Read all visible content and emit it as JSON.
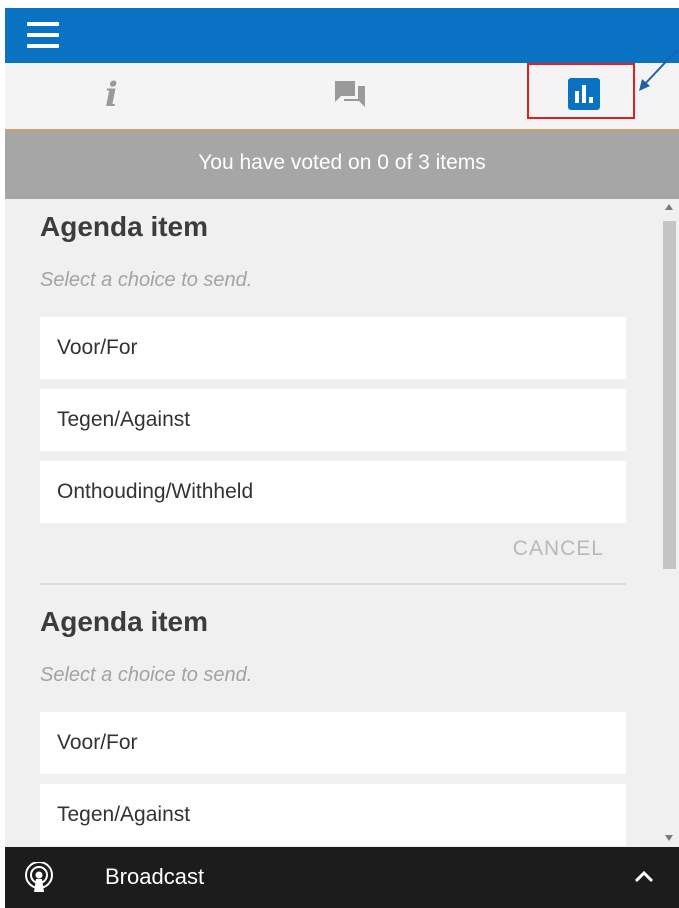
{
  "tabs": [
    {
      "id": "info",
      "icon": "info-icon"
    },
    {
      "id": "chat",
      "icon": "chat-icon"
    },
    {
      "id": "vote",
      "icon": "poll-icon",
      "active": true
    }
  ],
  "status": {
    "text": "You have voted on 0 of 3 items"
  },
  "agenda": [
    {
      "title": "Agenda item",
      "hint": "Select a choice to send.",
      "choices": [
        "Voor/For",
        "Tegen/Against",
        "Onthouding/Withheld"
      ],
      "cancel_label": "CANCEL"
    },
    {
      "title": "Agenda item",
      "hint": "Select a choice to send.",
      "choices": [
        "Voor/For",
        "Tegen/Against"
      ]
    }
  ],
  "bottom": {
    "label": "Broadcast",
    "icon": "broadcast-icon"
  },
  "colors": {
    "topbar": "#0a72c2",
    "accent": "#0a72c2",
    "status_bar": "#a6a6a6",
    "annotation": "#e02020",
    "bottom_bar": "#1c1c1c"
  }
}
